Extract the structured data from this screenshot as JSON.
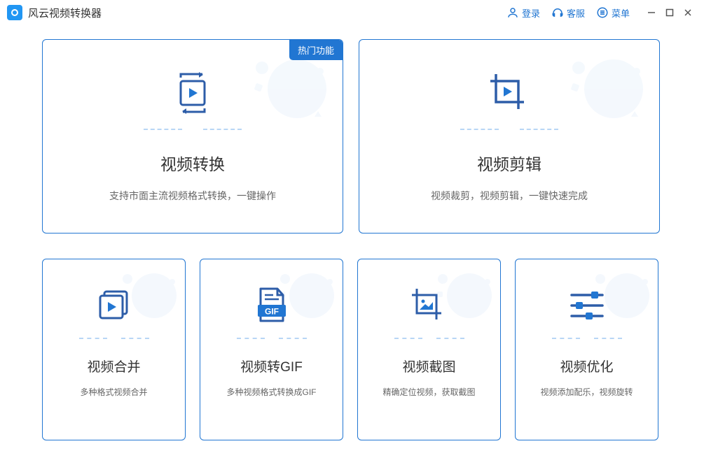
{
  "app": {
    "title": "风云视频转换器"
  },
  "header": {
    "login": "登录",
    "service": "客服",
    "menu": "菜单"
  },
  "cards": {
    "convert": {
      "title": "视频转换",
      "desc": "支持市面主流视频格式转换，一键操作",
      "badge": "热门功能"
    },
    "edit": {
      "title": "视频剪辑",
      "desc": "视频裁剪，视频剪辑，一键快速完成"
    },
    "merge": {
      "title": "视频合并",
      "desc": "多种格式视频合并"
    },
    "gif": {
      "title": "视频转GIF",
      "desc": "多种视频格式转换成GIF",
      "gif_label": "GIF"
    },
    "screenshot": {
      "title": "视频截图",
      "desc": "精确定位视频，获取截图"
    },
    "optimize": {
      "title": "视频优化",
      "desc": "视频添加配乐，视频旋转"
    }
  }
}
